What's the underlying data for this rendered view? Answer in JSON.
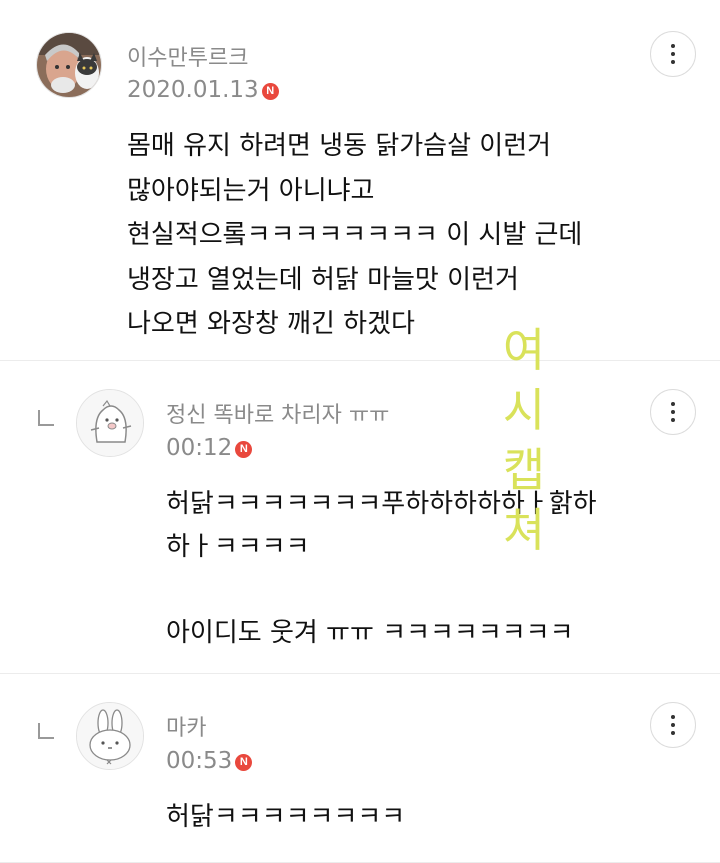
{
  "comments": [
    {
      "username": "이수만투르크",
      "date": "2020.01.13",
      "badge": "N",
      "lines": [
        "몸매 유지 하려면 냉동 닭가슴살 이런거",
        "많아야되는거 아니냐고",
        "현실적으롴ㅋㅋㅋㅋㅋㅋㅋㅋ 이 시발 근데",
        "냉장고 열었는데 허닭 마늘맛 이런거",
        "나오면 와장창 깨긴 하겠다"
      ],
      "avatar": "man-with-cat-avatar"
    },
    {
      "username": "정신 똑바로 차리자 ㅠㅠ",
      "date": "00:12",
      "badge": "N",
      "lines": [
        "허닭ㅋㅋㅋㅋㅋㅋㅋ푸하하하하하ㅏ핡하",
        "하ㅏㅋㅋㅋㅋ",
        "",
        "아이디도 웃겨 ㅠㅠ ㅋㅋㅋㅋㅋㅋㅋㅋ"
      ],
      "avatar": "pig-mascot-avatar"
    },
    {
      "username": "마카",
      "date": "00:53",
      "badge": "N",
      "lines": [
        "허닭ㅋㅋㅋㅋㅋㅋㅋㅋ"
      ],
      "avatar": "rabbit-avatar"
    }
  ],
  "watermark": [
    "여",
    "시",
    "캡",
    "쳐"
  ],
  "colors": {
    "badge": "#e9483d",
    "watermark": "#d9e25a",
    "meta": "#8a8a8a"
  }
}
